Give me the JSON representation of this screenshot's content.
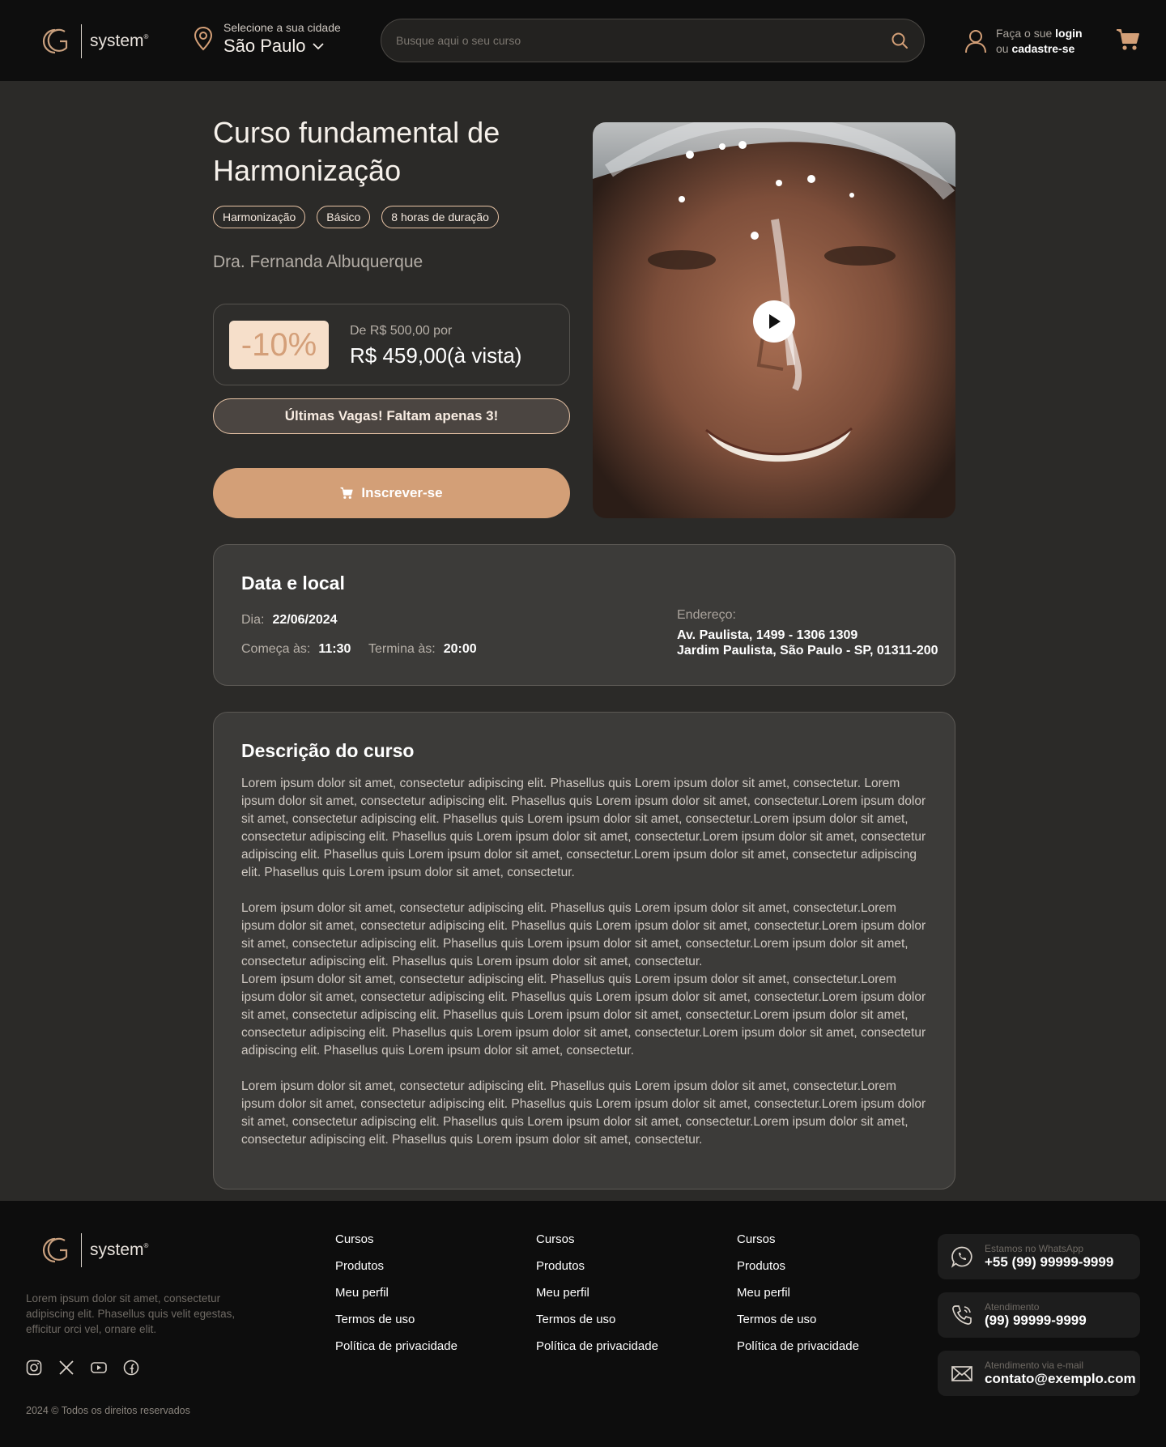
{
  "colors": {
    "accent": "#d39f77",
    "tag_border": "#e8c4a6",
    "discount_bg": "#f6dfca",
    "header_bg": "#0e0e0e",
    "page_bg": "#2b2a28"
  },
  "header": {
    "logo": {
      "word": "system",
      "mark": "GC"
    },
    "city": {
      "label": "Selecione a sua cidade",
      "name": "São Paulo"
    },
    "search": {
      "placeholder": "Busque aqui o seu curso"
    },
    "login": {
      "prefix": "Faça o sue ",
      "login": "login",
      "or": "ou ",
      "signup": "cadastre-se"
    },
    "icons": [
      "location-pin-icon",
      "chevron-down-icon",
      "search-icon",
      "user-icon",
      "cart-icon"
    ]
  },
  "course": {
    "title": "Curso fundamental de Harmonização",
    "tags": [
      "Harmonização",
      "Básico",
      "8 horas de duração"
    ],
    "author": "Dra. Fernanda Albuquerque",
    "discount": "-10%",
    "old_price": "De R$ 500,00 por",
    "new_price": "R$ 459,00(à vista)",
    "alert": "Últimas Vagas! Faltam apenas 3!",
    "enroll": "Inscrever-se"
  },
  "date_card": {
    "title": "Data e local",
    "day_label": "Dia:",
    "day": "22/06/2024",
    "start_label": "Começa às:",
    "start": "11:30",
    "end_label": "Termina às:",
    "end": "20:00",
    "address_label": "Endereço:",
    "address_line1": "Av. Paulista, 1499 - 1306 1309",
    "address_line2": "Jardim Paulista, São Paulo - SP, 01311-200"
  },
  "description": {
    "title": "Descrição do curso",
    "paragraphs": [
      "Lorem ipsum dolor sit amet, consectetur adipiscing elit. Phasellus quis Lorem ipsum dolor sit amet, consectetur. Lorem ipsum dolor sit amet, consectetur adipiscing elit. Phasellus quis Lorem ipsum dolor sit amet, consectetur.Lorem ipsum dolor sit amet, consectetur adipiscing elit. Phasellus quis Lorem ipsum dolor sit amet, consectetur.Lorem ipsum dolor sit amet, consectetur adipiscing elit. Phasellus quis Lorem ipsum dolor sit amet, consectetur.Lorem ipsum dolor sit amet, consectetur adipiscing elit. Phasellus quis Lorem ipsum dolor sit amet, consectetur.Lorem ipsum dolor sit amet, consectetur adipiscing elit. Phasellus quis Lorem ipsum dolor sit amet, consectetur.",
      "Lorem ipsum dolor sit amet, consectetur adipiscing elit. Phasellus quis Lorem ipsum dolor sit amet, consectetur.Lorem ipsum dolor sit amet, consectetur adipiscing elit. Phasellus quis Lorem ipsum dolor sit amet, consectetur.Lorem ipsum dolor sit amet, consectetur adipiscing elit. Phasellus quis Lorem ipsum dolor sit amet, consectetur.Lorem ipsum dolor sit amet, consectetur adipiscing elit. Phasellus quis Lorem ipsum dolor sit amet, consectetur.",
      "Lorem ipsum dolor sit amet, consectetur adipiscing elit. Phasellus quis Lorem ipsum dolor sit amet, consectetur.Lorem ipsum dolor sit amet, consectetur adipiscing elit. Phasellus quis Lorem ipsum dolor sit amet, consectetur.Lorem ipsum dolor sit amet, consectetur adipiscing elit. Phasellus quis Lorem ipsum dolor sit amet, consectetur.Lorem ipsum dolor sit amet, consectetur adipiscing elit. Phasellus quis Lorem ipsum dolor sit amet, consectetur.Lorem ipsum dolor sit amet, consectetur adipiscing elit. Phasellus quis Lorem ipsum dolor sit amet, consectetur.",
      "Lorem ipsum dolor sit amet, consectetur adipiscing elit. Phasellus quis Lorem ipsum dolor sit amet, consectetur.Lorem ipsum dolor sit amet, consectetur adipiscing elit. Phasellus quis Lorem ipsum dolor sit amet, consectetur.Lorem ipsum dolor sit amet, consectetur adipiscing elit. Phasellus quis Lorem ipsum dolor sit amet, consectetur.Lorem ipsum dolor sit amet, consectetur adipiscing elit. Phasellus quis Lorem ipsum dolor sit amet, consectetur."
    ]
  },
  "footer": {
    "text": "Lorem ipsum dolor sit amet, consectetur adipiscing elit. Phasellus quis velit egestas, efficitur orci vel, ornare elit.",
    "copyright": "2024 © Todos os direitos reservados",
    "social_icons": [
      "instagram-icon",
      "x-icon",
      "youtube-icon",
      "facebook-icon"
    ],
    "columns": [
      [
        "Cursos",
        "Produtos",
        "Meu perfil",
        "Termos de uso",
        "Política de privacidade"
      ],
      [
        "Cursos",
        "Produtos",
        "Meu perfil",
        "Termos de uso",
        "Política de privacidade"
      ],
      [
        "Cursos",
        "Produtos",
        "Meu perfil",
        "Termos de uso",
        "Política de privacidade"
      ]
    ],
    "contacts": [
      {
        "icon": "whatsapp-icon",
        "label": "Estamos no WhatsApp",
        "value": "+55 (99) 99999-9999"
      },
      {
        "icon": "phone-icon",
        "label": "Atendimento",
        "value": "(99) 99999-9999"
      },
      {
        "icon": "mail-icon",
        "label": "Atendimento via e-mail",
        "value": "contato@exemplo.com"
      }
    ]
  }
}
